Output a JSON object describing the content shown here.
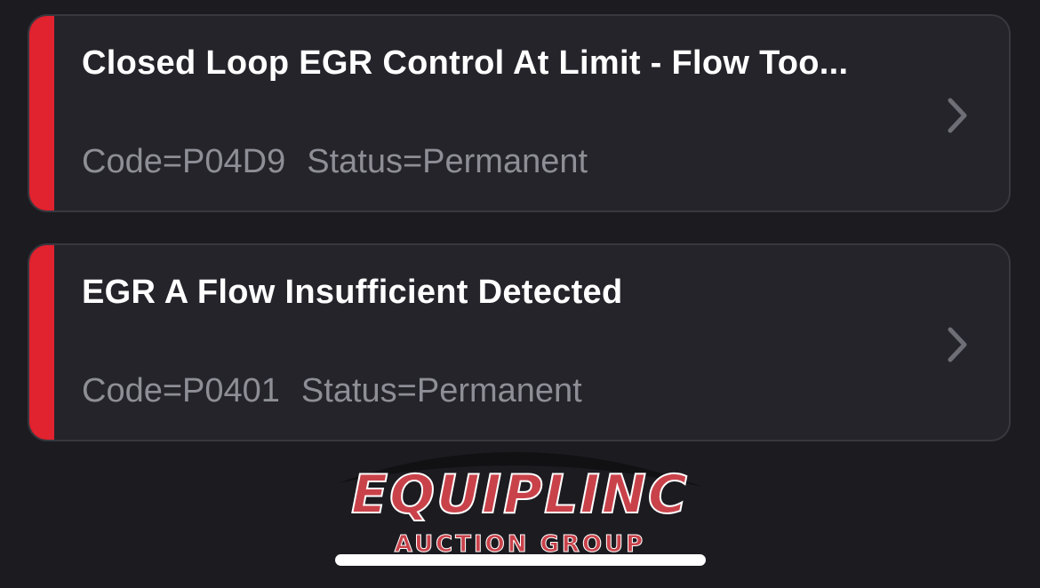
{
  "fault_codes": [
    {
      "title": "Closed Loop EGR Control At Limit - Flow Too...",
      "code_text": "Code=P04D9",
      "status_text": "Status=Permanent",
      "severity_color": "#e1222f",
      "icon": "chevron-right-icon"
    },
    {
      "title": "EGR A Flow Insufficient Detected",
      "code_text": "Code=P0401",
      "status_text": "Status=Permanent",
      "severity_color": "#e1222f",
      "icon": "chevron-right-icon"
    }
  ],
  "watermark": {
    "brand": "EQUIPLINC",
    "tagline": "AUCTION GROUP"
  }
}
